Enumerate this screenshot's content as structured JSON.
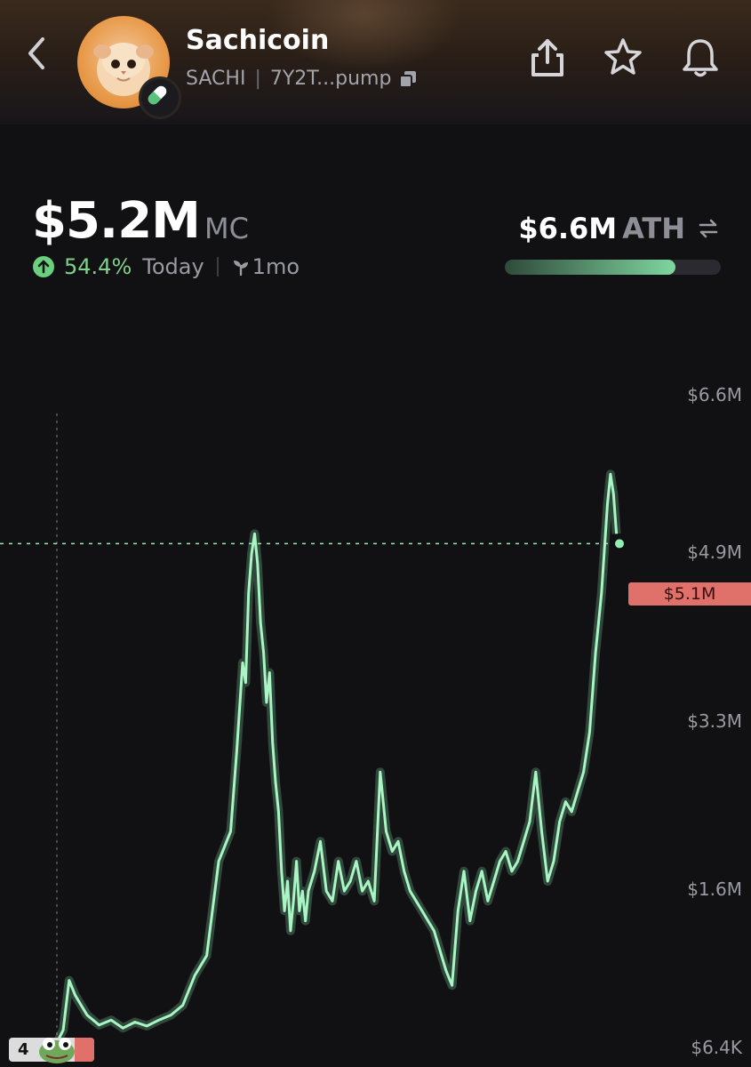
{
  "header": {
    "title": "Sachicoin",
    "ticker": "SACHI",
    "address": "7Y2T...pump"
  },
  "market": {
    "mc_value": "$5.2M",
    "mc_unit": "MC",
    "change_pct": "54.4%",
    "change_period": "Today",
    "age": "1mo",
    "ath_value": "$6.6M",
    "ath_label": "ATH",
    "ath_progress": 0.79
  },
  "chart": {
    "current_price_label": "$5.1M",
    "start_badge_count": "4",
    "icons": {
      "start_badge": "frog-icon"
    }
  },
  "colors": {
    "line": "#8ff0b0",
    "up": "#7fd08a",
    "price_tag": "#e0706a"
  },
  "chart_data": {
    "type": "line",
    "y_ticks": [
      "$6.6M",
      "$4.9M",
      "$3.3M",
      "$1.6M",
      "$6.4K"
    ],
    "ylim": [
      0.0064,
      6.6
    ],
    "current_value": 5.1,
    "x": [
      0,
      0.02,
      0.04,
      0.06,
      0.07,
      0.08,
      0.09,
      0.11,
      0.13,
      0.15,
      0.17,
      0.19,
      0.21,
      0.23,
      0.25,
      0.27,
      0.29,
      0.31,
      0.33,
      0.35,
      0.36,
      0.37,
      0.375,
      0.38,
      0.385,
      0.39,
      0.395,
      0.4,
      0.405,
      0.41,
      0.415,
      0.42,
      0.425,
      0.43,
      0.435,
      0.44,
      0.445,
      0.45,
      0.455,
      0.46,
      0.465,
      0.47,
      0.475,
      0.48,
      0.49,
      0.5,
      0.51,
      0.52,
      0.53,
      0.54,
      0.55,
      0.56,
      0.57,
      0.58,
      0.59,
      0.6,
      0.61,
      0.62,
      0.63,
      0.64,
      0.65,
      0.66,
      0.67,
      0.68,
      0.69,
      0.7,
      0.71,
      0.72,
      0.73,
      0.74,
      0.75,
      0.76,
      0.77,
      0.78,
      0.79,
      0.8,
      0.81,
      0.82,
      0.83,
      0.84,
      0.85,
      0.86,
      0.87,
      0.88,
      0.89,
      0.9,
      0.91,
      0.92,
      0.93,
      0.94,
      0.95,
      0.96,
      0.97,
      0.98,
      0.985,
      0.99,
      0.995,
      1.0
    ],
    "y": [
      0.01,
      0.03,
      0.05,
      0.08,
      0.2,
      0.7,
      0.55,
      0.35,
      0.25,
      0.3,
      0.22,
      0.28,
      0.24,
      0.3,
      0.35,
      0.45,
      0.75,
      0.95,
      1.9,
      2.2,
      3.0,
      3.9,
      3.7,
      4.6,
      5.0,
      5.2,
      4.9,
      4.3,
      4.0,
      3.5,
      3.8,
      3.1,
      2.7,
      2.4,
      1.8,
      1.4,
      1.7,
      1.2,
      1.5,
      1.9,
      1.4,
      1.6,
      1.3,
      1.6,
      1.8,
      2.1,
      1.6,
      1.5,
      1.9,
      1.6,
      1.7,
      1.9,
      1.6,
      1.7,
      1.5,
      2.8,
      2.2,
      2.0,
      2.1,
      1.8,
      1.6,
      1.5,
      1.4,
      1.3,
      1.2,
      1.0,
      0.8,
      0.65,
      1.4,
      1.8,
      1.3,
      1.6,
      1.8,
      1.5,
      1.7,
      1.9,
      2.0,
      1.8,
      1.9,
      2.1,
      2.3,
      2.8,
      2.2,
      1.7,
      1.9,
      2.3,
      2.5,
      2.4,
      2.6,
      2.8,
      3.2,
      4.0,
      4.6,
      5.5,
      5.8,
      5.6,
      5.2
    ]
  }
}
